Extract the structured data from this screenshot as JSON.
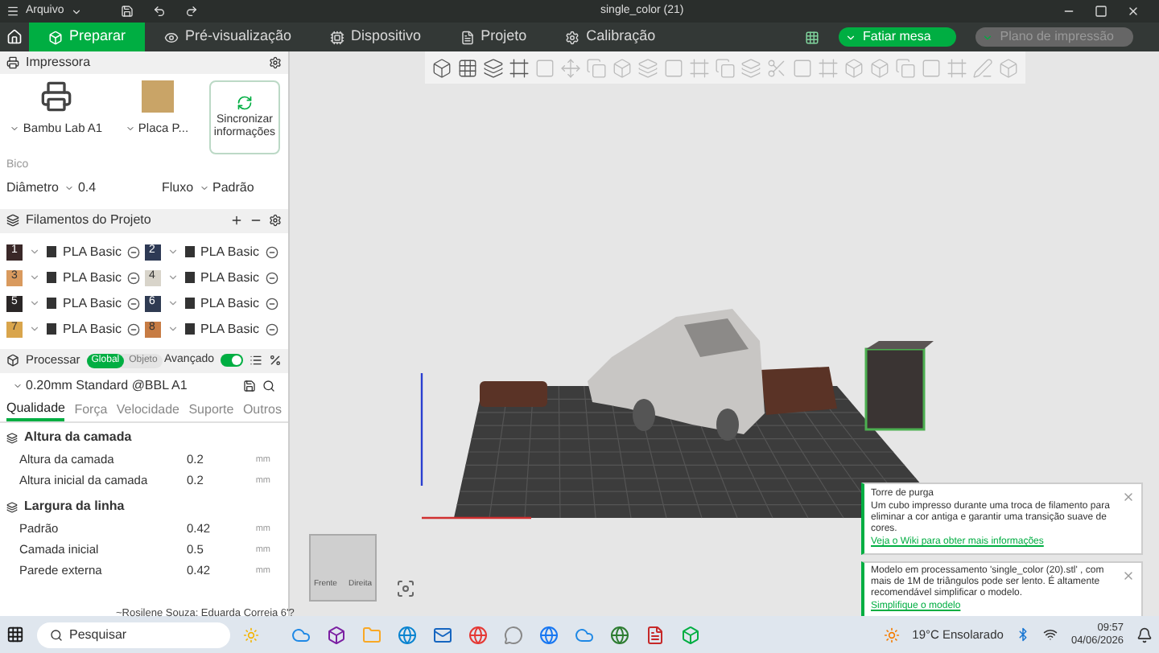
{
  "window": {
    "menu": "Arquivo",
    "title": "single_color (21)"
  },
  "tabs": [
    {
      "label": "Preparar",
      "selected": true
    },
    {
      "label": "Pré-visualização",
      "selected": false
    },
    {
      "label": "Dispositivo",
      "selected": false
    },
    {
      "label": "Projeto",
      "selected": false
    },
    {
      "label": "Calibração",
      "selected": false
    }
  ],
  "actions": {
    "slice": "Fatiar mesa",
    "print": "Plano de impressão"
  },
  "printer": {
    "title": "Impressora",
    "printer_name": "Bambu Lab A1",
    "plate": "Placa P...",
    "sync": "Sincronizar informações",
    "nozzle_label": "Bico",
    "diameter_label": "Diâmetro",
    "diameter": "0.4",
    "flow_label": "Fluxo",
    "flow": "Padrão"
  },
  "filaments": {
    "title": "Filamentos do Projeto",
    "items": [
      {
        "slot": "1",
        "name": "PLA Basic",
        "color": "#3a2828"
      },
      {
        "slot": "2",
        "name": "PLA Basic",
        "color": "#2e3a55"
      },
      {
        "slot": "3",
        "name": "PLA Basic",
        "color": "#d99a5e"
      },
      {
        "slot": "4",
        "name": "PLA Basic",
        "color": "#d8d4ca"
      },
      {
        "slot": "5",
        "name": "PLA Basic",
        "color": "#2a2626"
      },
      {
        "slot": "6",
        "name": "PLA Basic",
        "color": "#2f3b52"
      },
      {
        "slot": "7",
        "name": "PLA Basic",
        "color": "#d9a54c"
      },
      {
        "slot": "8",
        "name": "PLA Basic",
        "color": "#c77c44"
      }
    ]
  },
  "process": {
    "title": "Processar",
    "modes": [
      {
        "label": "Global",
        "selected": true
      },
      {
        "label": "Objeto",
        "selected": false
      }
    ],
    "advanced_label": "Avançado",
    "advanced": true,
    "preset": "0.20mm Standard @BBL A1",
    "tabs": [
      {
        "label": "Qualidade",
        "selected": true
      },
      {
        "label": "Força",
        "selected": false
      },
      {
        "label": "Velocidade",
        "selected": false
      },
      {
        "label": "Suporte",
        "selected": false
      },
      {
        "label": "Outros",
        "selected": false
      }
    ],
    "groups": [
      {
        "title": "Altura da camada",
        "rows": [
          {
            "label": "Altura da camada",
            "value": "0.2",
            "unit": "mm"
          },
          {
            "label": "Altura inicial da camada",
            "value": "0.2",
            "unit": "mm"
          }
        ]
      },
      {
        "title": "Largura da linha",
        "rows": [
          {
            "label": "Padrão",
            "value": "0.42",
            "unit": "mm"
          },
          {
            "label": "Camada inicial",
            "value": "0.5",
            "unit": "mm"
          },
          {
            "label": "Parede externa",
            "value": "0.42",
            "unit": "mm"
          }
        ]
      }
    ]
  },
  "nav_cube": {
    "front": "Frente",
    "right": "Direita"
  },
  "notifications": [
    {
      "title": "Torre de purga",
      "body": "Um cubo impresso durante uma troca de filamento para eliminar a cor antiga e garantir uma transição suave de cores.",
      "link": "Veja o Wiki para obter mais informações"
    },
    {
      "body": "Modelo em processamento 'single_color (20).stl' , com mais de 1M de triângulos pode ser lento. É altamente recomendável simplificar o modelo.",
      "link": "Simplifique o modelo"
    }
  ],
  "ticker": "~Rosilene Souza: Eduarda Correia 6'?",
  "taskbar": {
    "search": "Pesquisar",
    "weather": "19°C Ensolarado",
    "time": "09:57",
    "date": "04/06/2026"
  }
}
